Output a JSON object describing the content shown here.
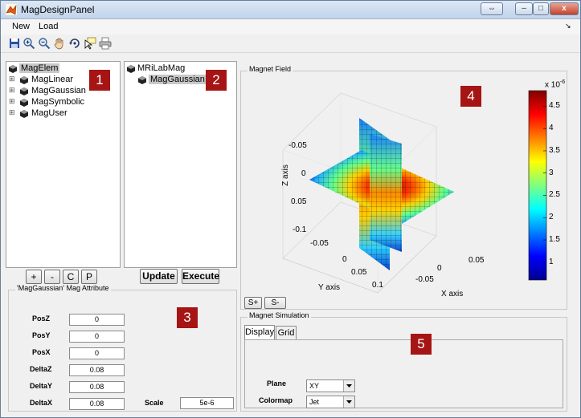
{
  "window": {
    "title": "MagDesignPanel",
    "min_label": "–",
    "max_label": "□",
    "close_label": "x"
  },
  "menu": {
    "items": [
      "New",
      "Load"
    ],
    "arrow": "↘"
  },
  "toolbar": {
    "icons": [
      "save-icon",
      "zoom-in-icon",
      "zoom-out-icon",
      "pan-hand-icon",
      "rotate-3d-icon",
      "data-cursor-icon",
      "print-icon"
    ]
  },
  "tree_left": {
    "items": [
      {
        "label": "MagElem",
        "selected": true
      },
      {
        "label": "MagLinear"
      },
      {
        "label": "MagGaussian"
      },
      {
        "label": "MagSymbolic"
      },
      {
        "label": "MagUser"
      }
    ]
  },
  "tree_right": {
    "items": [
      {
        "label": "MRiLabMag"
      },
      {
        "label": "MagGaussian",
        "selected": true
      }
    ]
  },
  "tree_buttons": {
    "add": "+",
    "remove": "-",
    "copy": "C",
    "paste": "P"
  },
  "actions": {
    "update": "Update",
    "execute": "Execute"
  },
  "markers": [
    "1",
    "2",
    "3",
    "4",
    "5"
  ],
  "attributes": {
    "title": "'MagGaussian' Mag Attribute",
    "fields": [
      {
        "label": "PosZ",
        "value": "0"
      },
      {
        "label": "PosY",
        "value": "0"
      },
      {
        "label": "PosX",
        "value": "0"
      },
      {
        "label": "DeltaZ",
        "value": "0.08"
      },
      {
        "label": "DeltaY",
        "value": "0.08"
      },
      {
        "label": "DeltaX",
        "value": "0.08"
      }
    ],
    "scale_label": "Scale",
    "scale_value": "5e-6"
  },
  "magnet_field": {
    "title": "Magnet Field",
    "zoom_in": "S+",
    "zoom_out": "S-",
    "colorbar": {
      "exponent": "x 10",
      "exponent_power": "-6",
      "ticks": [
        "4.5",
        "4",
        "3.5",
        "3",
        "2.5",
        "2",
        "1.5",
        "1"
      ],
      "colormap": "jet"
    },
    "axes": {
      "z_label": "Z axis",
      "y_label": "Y axis",
      "x_label": "X axis",
      "z_ticks": [
        "-0.05",
        "0",
        "0.05",
        "-0.1"
      ],
      "y_ticks": [
        "-0.05",
        "0",
        "0.05",
        "0.1"
      ],
      "x_ticks": [
        "0.05",
        "0",
        "-0.05"
      ]
    }
  },
  "simulation": {
    "title": "Magnet Simulation",
    "tabs": [
      {
        "label": "Display",
        "active": true
      },
      {
        "label": "Grid"
      }
    ],
    "plane_label": "Plane",
    "plane_value": "XY",
    "colormap_label": "Colormap",
    "colormap_value": "Jet"
  },
  "colors": {
    "marker": "#a61414",
    "selection": "#c8c8c8"
  }
}
